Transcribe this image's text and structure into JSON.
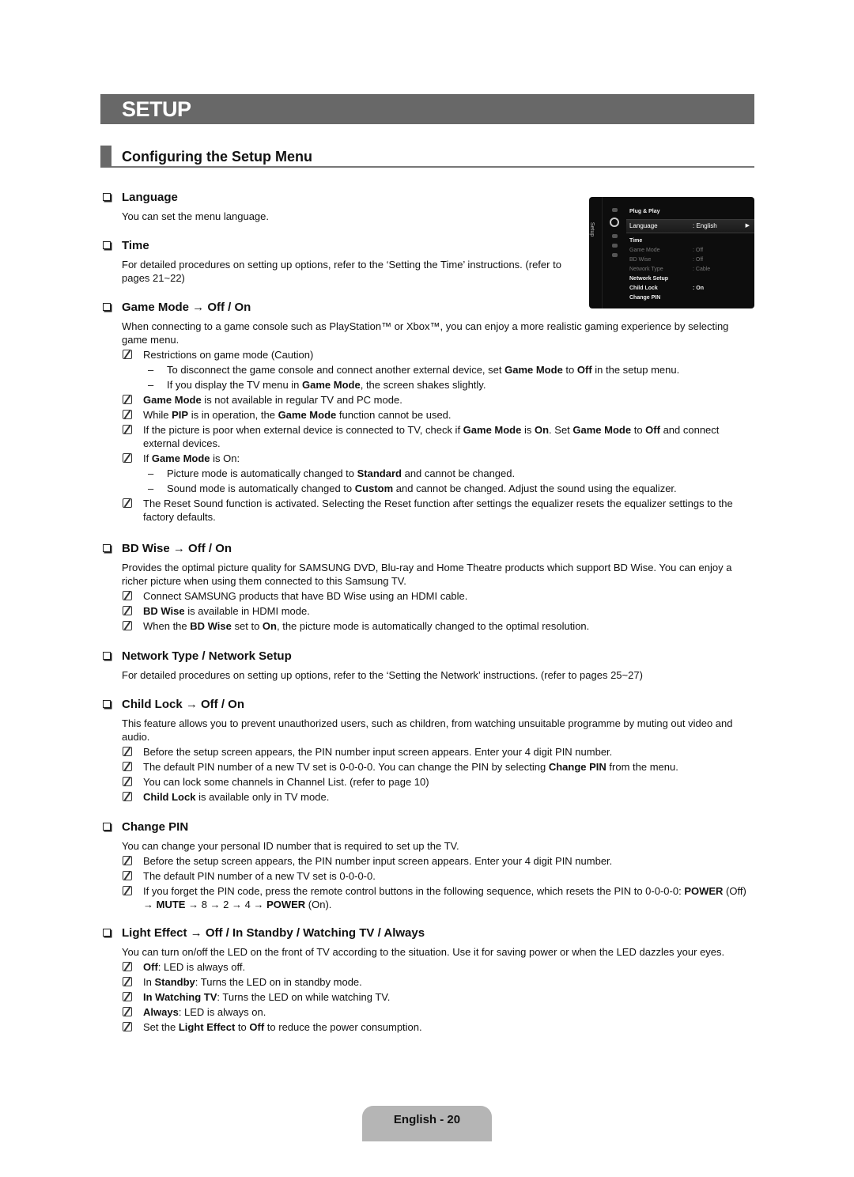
{
  "page": {
    "banner_title": "SETUP",
    "section_title": "Configuring the Setup Menu",
    "footer": "English - 20"
  },
  "tv_menu": {
    "side_label": "Setup",
    "rows": [
      {
        "label": "Plug & Play",
        "value": "",
        "style": "bright"
      },
      {
        "label": "Language",
        "value": ": English",
        "style": "selected"
      },
      {
        "label": "Time",
        "value": "",
        "style": "bright"
      },
      {
        "label": "Game Mode",
        "value": ": Off",
        "style": "dim"
      },
      {
        "label": "BD Wise",
        "value": ": Off",
        "style": "dim"
      },
      {
        "label": "Network Type",
        "value": ": Cable",
        "style": "dim"
      },
      {
        "label": "Network Setup",
        "value": "",
        "style": "bright"
      },
      {
        "label": "Child Lock",
        "value": ": On",
        "style": "bright"
      },
      {
        "label": "Change PIN",
        "value": "",
        "style": "bright"
      }
    ],
    "arrow": "▶"
  },
  "items": {
    "language": {
      "title": "Language",
      "desc": "You can set the menu language."
    },
    "time": {
      "title": "Time",
      "desc": "For detailed procedures on setting up options, refer to the ‘Setting the Time’ instructions. (refer to pages 21~22)"
    },
    "game_mode": {
      "title": "Game Mode → Off / On",
      "desc": "When connecting to a game console such as PlayStation™ or Xbox™, you can enjoy a more realistic gaming experience by selecting game menu.",
      "note1": "Restrictions on game mode (Caution)",
      "sub1_pre": "To disconnect the game console and connect another external device, set ",
      "sub1_b1": "Game Mode",
      "sub1_mid": " to ",
      "sub1_b2": "Off",
      "sub1_post": " in the setup menu.",
      "sub2_pre": "If you display the TV menu in ",
      "sub2_b": "Game Mode",
      "sub2_post": ", the screen shakes slightly.",
      "note2_b": "Game Mode",
      "note2_post": " is not available in regular TV and PC mode.",
      "note3_pre": "While ",
      "note3_b1": "PIP",
      "note3_mid": " is in operation, the ",
      "note3_b2": "Game Mode",
      "note3_post": " function cannot be used.",
      "note4_pre": "If the picture is poor when external device is connected to TV, check if ",
      "note4_b1": "Game Mode",
      "note4_m1": " is ",
      "note4_b2": "On",
      "note4_m2": ". Set ",
      "note4_b3": "Game Mode",
      "note4_m3": " to ",
      "note4_b4": "Off",
      "note4_post": " and connect external devices.",
      "note5_pre": "If ",
      "note5_b": "Game Mode",
      "note5_post": " is On:",
      "sub3_pre": "Picture mode is automatically changed to ",
      "sub3_b": "Standard",
      "sub3_post": " and cannot be changed.",
      "sub4_pre": "Sound mode is automatically changed to ",
      "sub4_b": "Custom",
      "sub4_post": " and cannot be changed. Adjust the sound using the equalizer.",
      "note6": "The Reset Sound function is activated. Selecting the Reset function after settings the equalizer resets the equalizer settings to the factory defaults."
    },
    "bd_wise": {
      "title": "BD Wise → Off / On",
      "desc": "Provides the optimal picture quality for SAMSUNG DVD, Blu-ray and Home Theatre products which support BD Wise. You can enjoy a richer picture when using them connected to this Samsung TV.",
      "note1": "Connect SAMSUNG products that have BD Wise using an HDMI cable.",
      "note2_b": "BD Wise",
      "note2_post": " is available in HDMI mode.",
      "note3_pre": "When the ",
      "note3_b1": "BD Wise",
      "note3_mid": " set to ",
      "note3_b2": "On",
      "note3_post": ", the picture mode is automatically changed to the optimal resolution."
    },
    "network": {
      "title": "Network Type / Network Setup",
      "desc": "For detailed procedures on setting up options, refer to the ‘Setting the Network’ instructions. (refer to pages 25~27)"
    },
    "child_lock": {
      "title": "Child Lock → Off / On",
      "desc": "This feature allows you to prevent unauthorized users, such as children, from watching unsuitable programme by muting out video and audio.",
      "note1": "Before the setup screen appears, the PIN number input screen appears. Enter your 4 digit PIN number.",
      "note2_pre": "The default PIN number of a new TV set is 0-0-0-0. You can change the PIN by selecting ",
      "note2_b": "Change PIN",
      "note2_post": " from the menu.",
      "note3": "You can lock some channels in Channel List. (refer to page 10)",
      "note4_b": "Child Lock",
      "note4_post": " is available only in TV mode."
    },
    "change_pin": {
      "title": "Change PIN",
      "desc": "You can change your personal ID number that is required to set up the TV.",
      "note1": "Before the setup screen appears, the PIN number input screen appears. Enter your 4 digit PIN number.",
      "note2": "The default PIN number of a new TV set is 0-0-0-0.",
      "note3_pre": "If you forget the PIN code, press the remote control buttons in the following sequence, which resets the PIN to 0-0-0-0: ",
      "note3_b1": "POWER",
      "note3_m1": " (Off) → ",
      "note3_b2": "MUTE",
      "note3_m2": " → 8 → 2 → 4 → ",
      "note3_b3": "POWER",
      "note3_post": " (On)."
    },
    "light_effect": {
      "title": "Light Effect → Off / In Standby / Watching TV / Always",
      "desc": "You can turn on/off the LED on the front of TV according to the situation. Use it for saving power or when the LED dazzles your eyes.",
      "note1_b": "Off",
      "note1_post": ": LED is always off.",
      "note2_pre": "In ",
      "note2_b": "Standby",
      "note2_post": ": Turns the LED on in standby mode.",
      "note3_b": "In Watching TV",
      "note3_post": ": Turns the LED on while watching TV.",
      "note4_b": "Always",
      "note4_post": ": LED is always on.",
      "note5_pre": "Set the ",
      "note5_b1": "Light Effect",
      "note5_mid": " to ",
      "note5_b2": "Off",
      "note5_post": " to reduce the power consumption."
    }
  }
}
